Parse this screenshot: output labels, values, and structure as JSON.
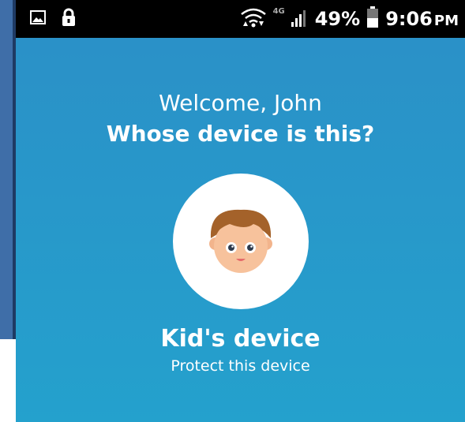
{
  "status_bar": {
    "left_icons": [
      "image-icon",
      "lock-icon"
    ],
    "network": "4G",
    "battery": "49%",
    "time": "9:06",
    "ampm": "PM"
  },
  "main": {
    "welcome": "Welcome, John",
    "question": "Whose device is this?",
    "option": {
      "label": "Kid's device",
      "subtitle": "Protect this device",
      "avatar": "kid-face-icon"
    }
  },
  "colors": {
    "background_top": "#2b8fc7",
    "background_bottom": "#24a1cd",
    "status_bar": "#000000",
    "text": "#ffffff"
  }
}
